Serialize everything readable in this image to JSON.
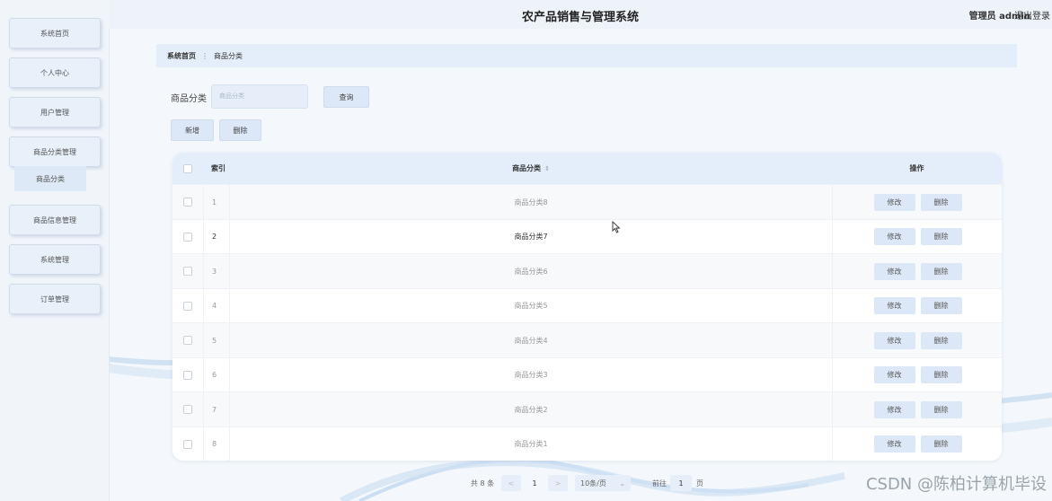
{
  "app": {
    "title": "农产品销售与管理系统",
    "user": "管理员 admin",
    "logout": "退出登录"
  },
  "sidebar": {
    "items": [
      {
        "label": "系统首页"
      },
      {
        "label": "个人中心"
      },
      {
        "label": "用户管理"
      },
      {
        "label": "商品分类管理"
      },
      {
        "label": "商品信息管理"
      },
      {
        "label": "系统管理"
      },
      {
        "label": "订单管理"
      }
    ],
    "submenu": {
      "label": "商品分类"
    }
  },
  "breadcrumb": {
    "home": "系统首页",
    "separator": "⋮",
    "current": "商品分类"
  },
  "search": {
    "label": "商品分类",
    "placeholder": "商品分类",
    "button": "查询"
  },
  "actions": {
    "add": "新增",
    "delete": "删除"
  },
  "table": {
    "headers": {
      "index": "索引",
      "name": "商品分类",
      "ops": "操作"
    },
    "rows": [
      {
        "index": "1",
        "name": "商品分类8"
      },
      {
        "index": "2",
        "name": "商品分类7"
      },
      {
        "index": "3",
        "name": "商品分类6"
      },
      {
        "index": "4",
        "name": "商品分类5"
      },
      {
        "index": "5",
        "name": "商品分类4"
      },
      {
        "index": "6",
        "name": "商品分类3"
      },
      {
        "index": "7",
        "name": "商品分类2"
      },
      {
        "index": "8",
        "name": "商品分类1"
      }
    ],
    "row_actions": {
      "edit": "修改",
      "delete": "删除"
    }
  },
  "pagination": {
    "total": "共 8 条",
    "prev": "<",
    "page": "1",
    "next": ">",
    "page_size": "10条/页",
    "goto_prefix": "前往",
    "goto_value": "1",
    "goto_suffix": "页"
  },
  "watermark": "CSDN @陈柏计算机毕设",
  "colors": {
    "sidebar_bg": "#f1f5fa",
    "button_bg": "#dce8f7",
    "header_bg": "#e4eefa"
  }
}
